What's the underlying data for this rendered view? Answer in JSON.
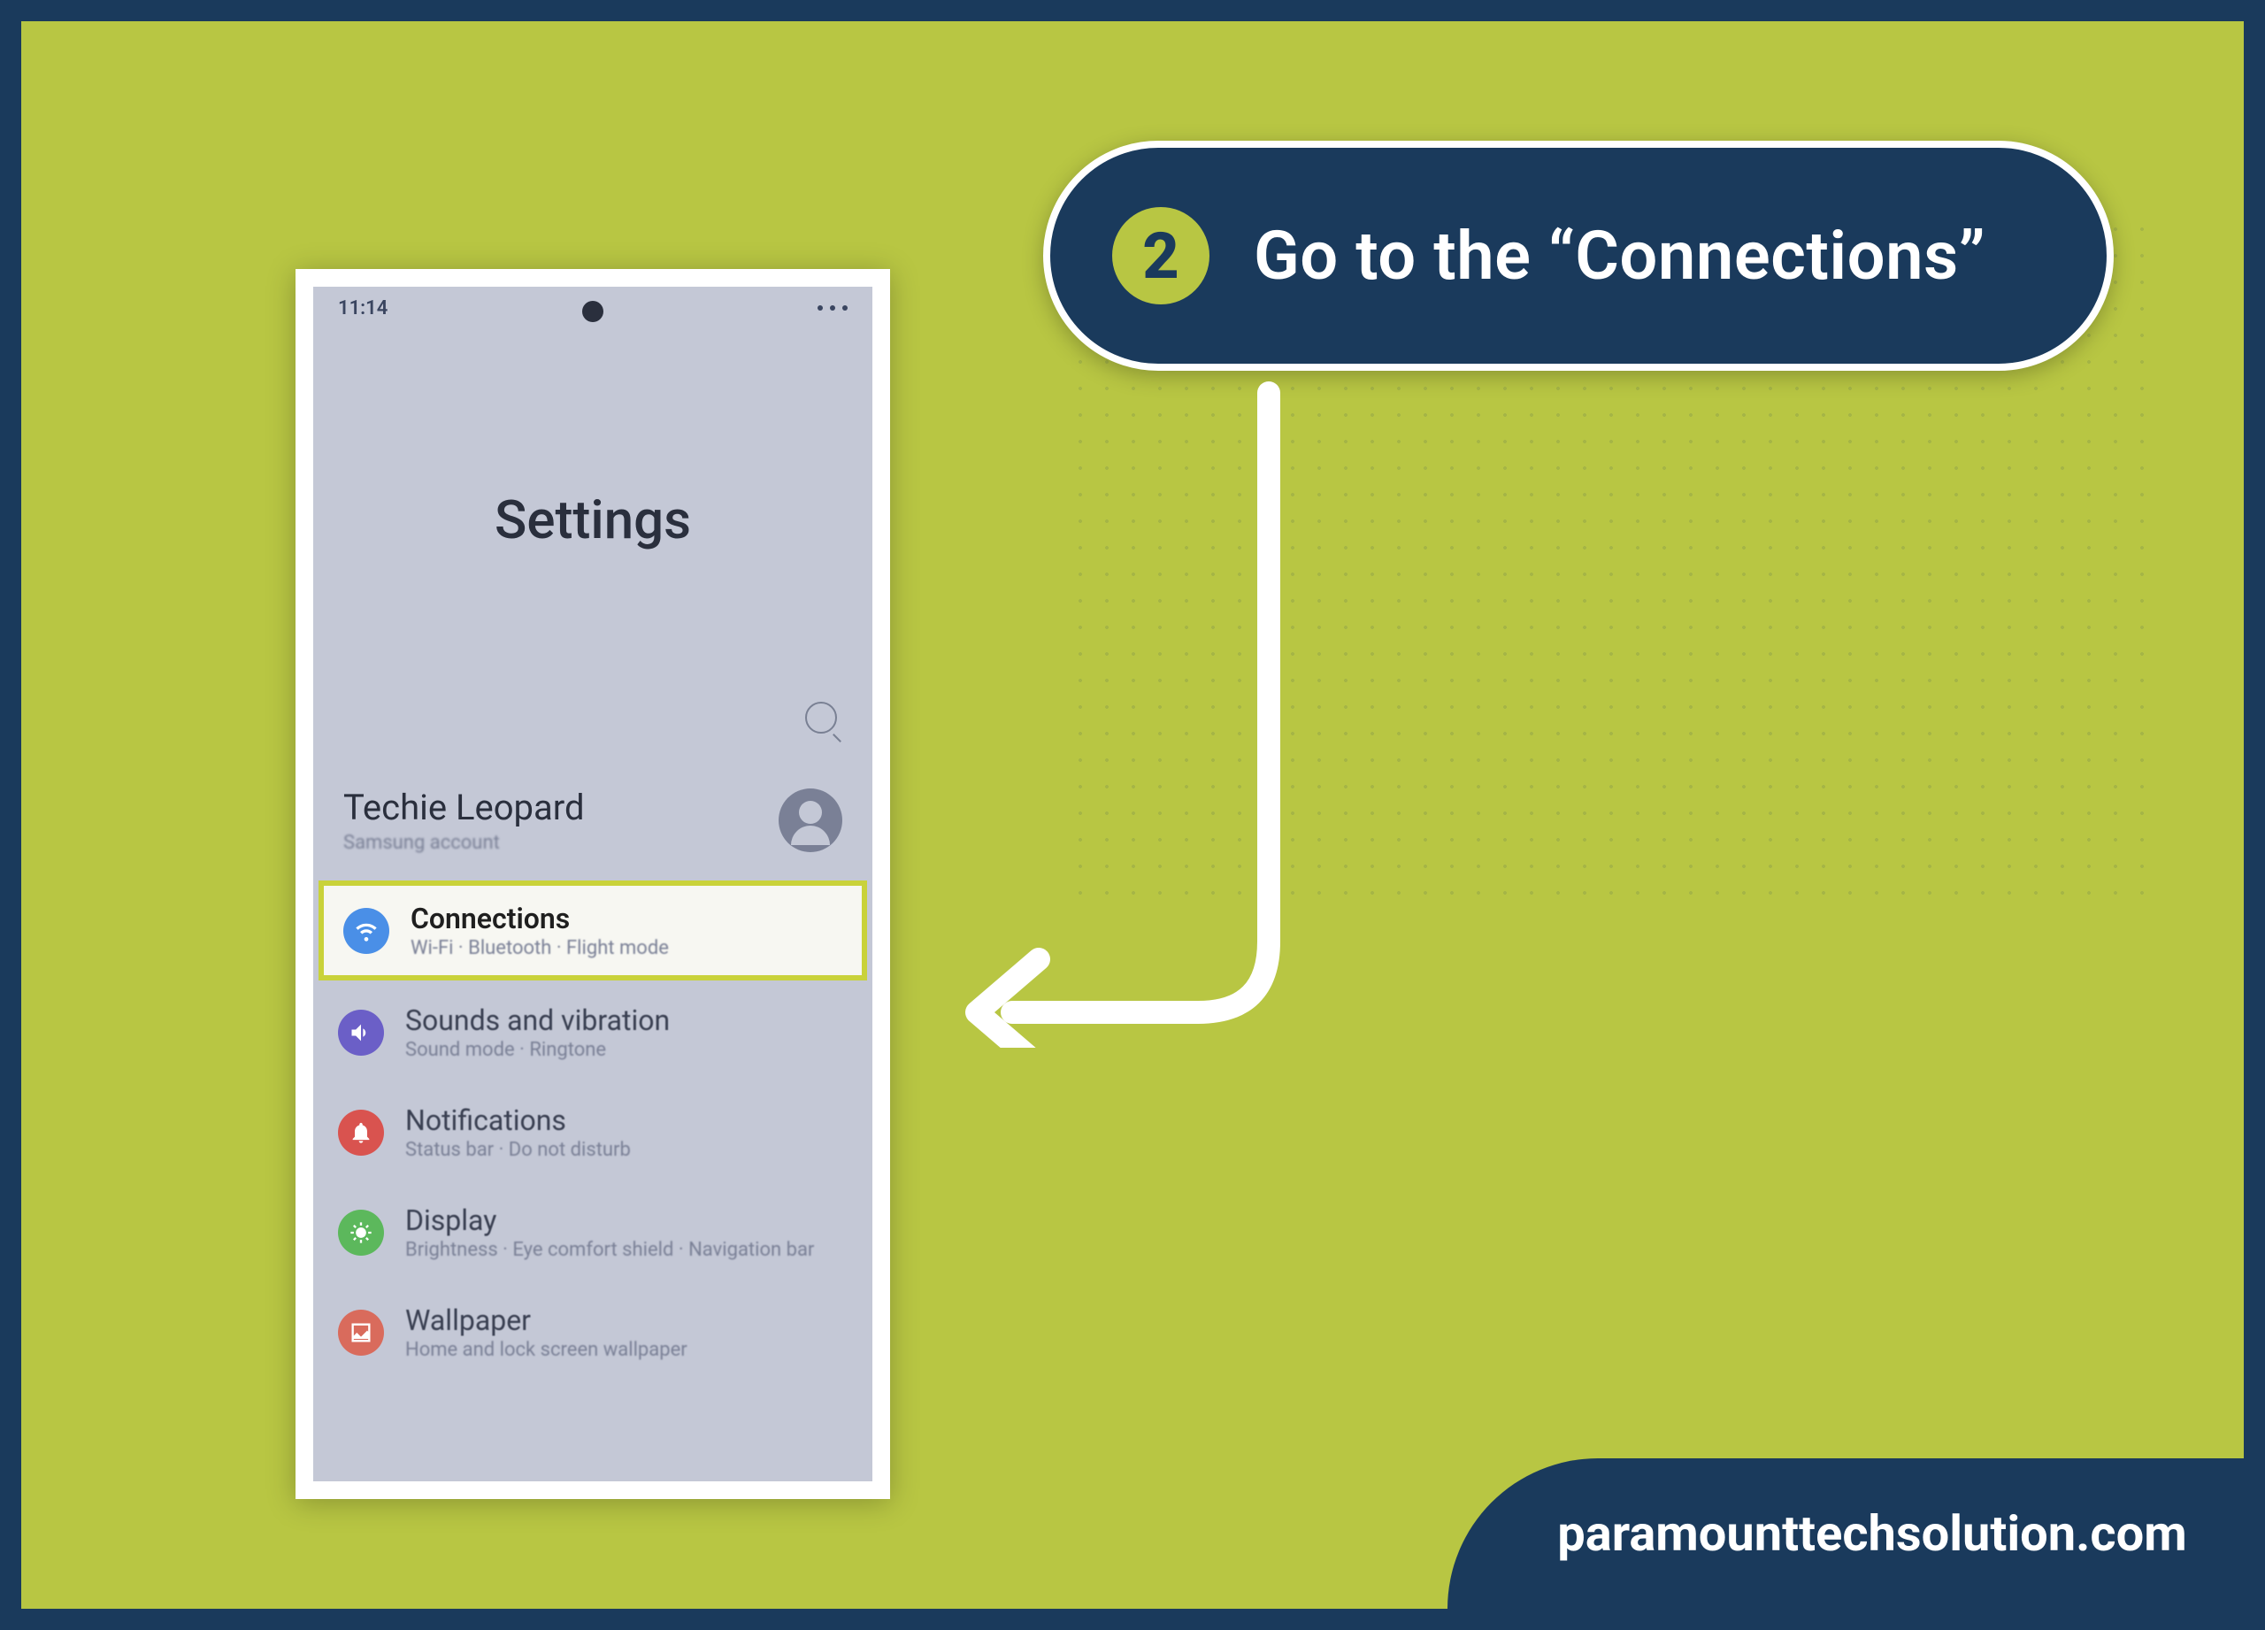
{
  "callout": {
    "step": "2",
    "text": "Go to the “Connections”"
  },
  "phone": {
    "status_time": "11:14",
    "screen_title": "Settings",
    "account_name": "Techie Leopard",
    "account_sub": "Samsung account",
    "items": [
      {
        "title": "Connections",
        "sub": "Wi-Fi · Bluetooth · Flight mode",
        "color": "#4a8fe7",
        "icon": "wifi",
        "highlight": true
      },
      {
        "title": "Sounds and vibration",
        "sub": "Sound mode · Ringtone",
        "color": "#6b5fc7",
        "icon": "sound",
        "highlight": false
      },
      {
        "title": "Notifications",
        "sub": "Status bar · Do not disturb",
        "color": "#d9534f",
        "icon": "notif",
        "highlight": false
      },
      {
        "title": "Display",
        "sub": "Brightness · Eye comfort shield · Navigation bar",
        "color": "#5cb85c",
        "icon": "display",
        "highlight": false
      },
      {
        "title": "Wallpaper",
        "sub": "Home and lock screen wallpaper",
        "color": "#d96b5c",
        "icon": "wallpaper",
        "highlight": false
      }
    ]
  },
  "footer": "paramounttechsolution.com"
}
